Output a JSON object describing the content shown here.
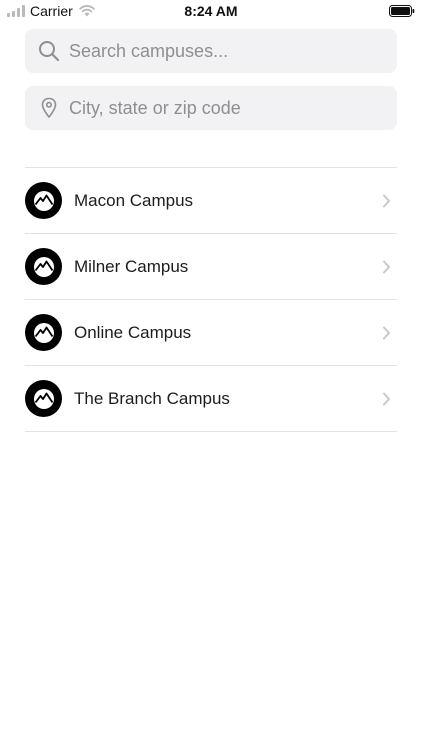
{
  "status_bar": {
    "carrier": "Carrier",
    "time": "8:24 AM"
  },
  "search": {
    "placeholder": "Search campuses...",
    "value": "",
    "icon": "search-icon"
  },
  "location": {
    "placeholder": "City, state or zip code",
    "value": "",
    "icon": "location-pin-icon"
  },
  "campuses": [
    {
      "name": "Macon Campus",
      "icon": "mountain-logo-icon"
    },
    {
      "name": "Milner Campus",
      "icon": "mountain-logo-icon"
    },
    {
      "name": "Online Campus",
      "icon": "mountain-logo-icon"
    },
    {
      "name": "The Branch Campus",
      "icon": "mountain-logo-icon"
    }
  ],
  "colors": {
    "field_background": "#f2f2f4",
    "placeholder": "#8e8e93",
    "divider": "#e3e3e6",
    "chevron": "#c7c7cc",
    "avatar": "#000000"
  }
}
